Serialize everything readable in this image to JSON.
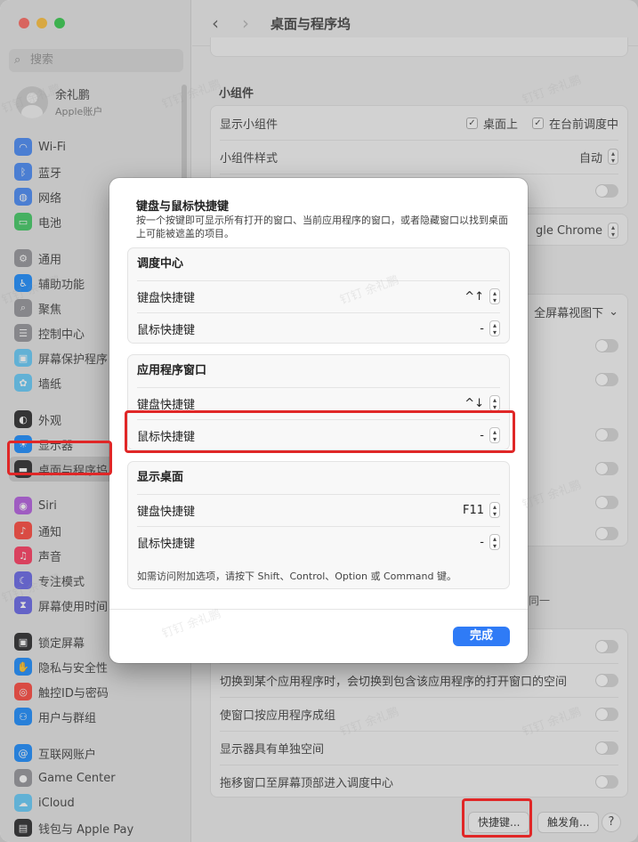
{
  "window": {
    "title": "桌面与程序坞",
    "traffic_colors": {
      "close": "#fe5f57",
      "minimize": "#febc2e",
      "zoom": "#28c840"
    }
  },
  "sidebar": {
    "search_placeholder": "搜索",
    "account": {
      "name": "余礼鹏",
      "subtitle": "Apple账户"
    },
    "items": [
      {
        "label": "Wi-Fi",
        "icon": "wifi-icon",
        "color": "#3b82f6"
      },
      {
        "label": "蓝牙",
        "icon": "bluetooth-icon",
        "color": "#3b82f6"
      },
      {
        "label": "网络",
        "icon": "globe-icon",
        "color": "#3b82f6"
      },
      {
        "label": "电池",
        "icon": "battery-icon",
        "color": "#34c759"
      },
      {
        "label": "通用",
        "icon": "gear-icon",
        "color": "#8e8e93"
      },
      {
        "label": "辅助功能",
        "icon": "accessibility-icon",
        "color": "#0a84ff"
      },
      {
        "label": "聚焦",
        "icon": "spotlight-icon",
        "color": "#8e8e93"
      },
      {
        "label": "控制中心",
        "icon": "control-center-icon",
        "color": "#8e8e93"
      },
      {
        "label": "屏幕保护程序",
        "icon": "screensaver-icon",
        "color": "#5ac8fa"
      },
      {
        "label": "墙纸",
        "icon": "wallpaper-icon",
        "color": "#5ac8fa"
      },
      {
        "label": "外观",
        "icon": "appearance-icon",
        "color": "#1c1c1e"
      },
      {
        "label": "显示器",
        "icon": "display-icon",
        "color": "#0a84ff"
      },
      {
        "label": "桌面与程序坞",
        "icon": "dock-icon",
        "color": "#1c1c1e"
      },
      {
        "label": "Siri",
        "icon": "siri-icon",
        "color": "#af52de"
      },
      {
        "label": "通知",
        "icon": "bell-icon",
        "color": "#ff3b30"
      },
      {
        "label": "声音",
        "icon": "speaker-icon",
        "color": "#ff2d55"
      },
      {
        "label": "专注模式",
        "icon": "moon-icon",
        "color": "#5e5ce6"
      },
      {
        "label": "屏幕使用时间",
        "icon": "hourglass-icon",
        "color": "#5e5ce6"
      },
      {
        "label": "锁定屏幕",
        "icon": "lock-icon",
        "color": "#1c1c1e"
      },
      {
        "label": "隐私与安全性",
        "icon": "hand-icon",
        "color": "#0a84ff"
      },
      {
        "label": "触控ID与密码",
        "icon": "fingerprint-icon",
        "color": "#ff3b30"
      },
      {
        "label": "用户与群组",
        "icon": "users-icon",
        "color": "#0a84ff"
      },
      {
        "label": "互联网账户",
        "icon": "at-icon",
        "color": "#0a84ff"
      },
      {
        "label": "Game Center",
        "icon": "game-center-icon",
        "color": "#8e8e93"
      },
      {
        "label": "iCloud",
        "icon": "cloud-icon",
        "color": "#5ac8fa"
      },
      {
        "label": "钱包与 Apple Pay",
        "icon": "wallet-icon",
        "color": "#1c1c1e"
      }
    ]
  },
  "main": {
    "widgets_section": "小组件",
    "show_widgets_label": "显示小组件",
    "show_on_desktop": "桌面上",
    "show_in_stage": "在台前调度中",
    "widget_style_label": "小组件样式",
    "widget_style_value": "自动",
    "browser_value": "gle Chrome",
    "fullscreen_value": "全屏幕视图下",
    "partial_text": "同一",
    "switch_space_label": "切换到某个应用程序时，会切换到包含该应用程序的打开窗口的空间",
    "group_windows_label": "使窗口按应用程序成组",
    "separate_spaces_label": "显示器具有单独空间",
    "drag_top_label": "拖移窗口至屏幕顶部进入调度中心",
    "shortcuts_button": "快捷键...",
    "hot_corners_button": "触发角...",
    "help_button": "?"
  },
  "sheet": {
    "title": "键盘与鼠标快捷键",
    "description": "按一个按键即可显示所有打开的窗口、当前应用程序的窗口，或者隐藏窗口以找到桌面上可能被遮盖的项目。",
    "groups": [
      {
        "title": "调度中心",
        "keyboard_label": "键盘快捷键",
        "keyboard_value": "^↑",
        "mouse_label": "鼠标快捷键",
        "mouse_value": "-"
      },
      {
        "title": "应用程序窗口",
        "keyboard_label": "键盘快捷键",
        "keyboard_value": "^↓",
        "mouse_label": "鼠标快捷键",
        "mouse_value": "-"
      },
      {
        "title": "显示桌面",
        "keyboard_label": "键盘快捷键",
        "keyboard_value": "F11",
        "mouse_label": "鼠标快捷键",
        "mouse_value": "-"
      }
    ],
    "note": "如需访问附加选项，请按下 Shift、Control、Option 或 Command 键。",
    "done_button": "完成"
  },
  "watermark": "钉钉 余礼鹏",
  "accent_color": "#2f7bf6",
  "highlight_color": "#e02727"
}
